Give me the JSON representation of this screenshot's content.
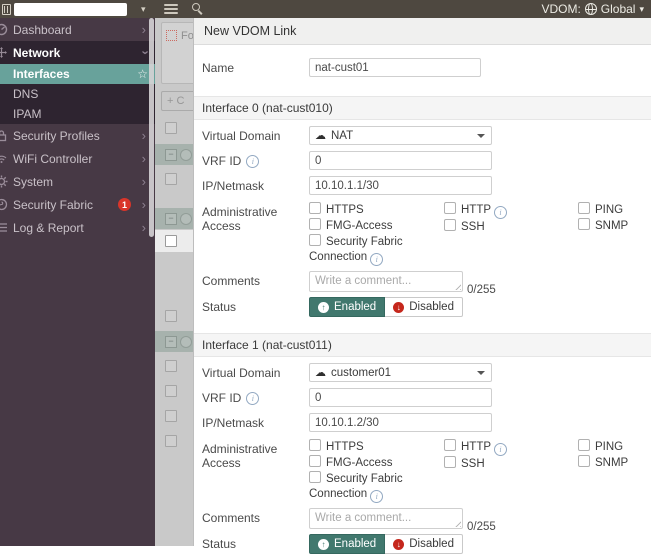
{
  "topbar": {
    "vdom_label": "VDOM:",
    "vdom_value": "Global"
  },
  "icons": {
    "chevron_right": "›",
    "star": "☆",
    "cloud": "☁",
    "info": "i",
    "up_arrow": "↑",
    "down_arrow": "↓",
    "minus": "−",
    "caret_down": "▾"
  },
  "sidebar": {
    "items": [
      {
        "label": "Dashboard",
        "icon": "gauge-icon"
      },
      {
        "label": "Network",
        "icon": "move-arrows-icon",
        "expanded": true,
        "children": [
          {
            "label": "Interfaces",
            "selected": true,
            "pinned": true
          },
          {
            "label": "DNS"
          },
          {
            "label": "IPAM"
          }
        ]
      },
      {
        "label": "Security Profiles",
        "icon": "lock-icon"
      },
      {
        "label": "WiFi Controller",
        "icon": "wifi-icon"
      },
      {
        "label": "System",
        "icon": "gear-icon"
      },
      {
        "label": "Security Fabric",
        "icon": "fabric-icon",
        "badge": "1"
      },
      {
        "label": "Log & Report",
        "icon": "report-icon"
      }
    ]
  },
  "background_page": {
    "widget_label": "Fo",
    "create_label": "+ C"
  },
  "panel": {
    "title": "New VDOM Link",
    "name": {
      "label": "Name",
      "value": "nat-cust01"
    },
    "labels": {
      "virtual_domain": "Virtual Domain",
      "vrf_id": "VRF ID",
      "ip_netmask": "IP/Netmask",
      "admin_access": "Administrative Access",
      "comments": "Comments",
      "comments_placeholder": "Write a comment...",
      "comments_counter": "0/255",
      "status": "Status",
      "enabled": "Enabled",
      "disabled": "Disabled"
    },
    "admin_access": {
      "col1": [
        "HTTPS",
        "FMG-Access",
        "Security Fabric Connection"
      ],
      "col2": [
        "HTTP",
        "SSH"
      ],
      "col3": [
        "PING",
        "SNMP"
      ]
    },
    "interfaces": [
      {
        "section_title": "Interface 0 (nat-cust010)",
        "virtual_domain": "NAT",
        "vrf_id": "0",
        "ip_netmask": "10.10.1.1/30",
        "status": "Enabled"
      },
      {
        "section_title": "Interface 1 (nat-cust011)",
        "virtual_domain": "customer01",
        "vrf_id": "0",
        "ip_netmask": "10.10.1.2/30",
        "status": "Enabled"
      }
    ]
  },
  "colors": {
    "topbar_bg": "#4e4840",
    "sidebar_bg": "#473945",
    "sidebar_expanded_bg": "#2e2430",
    "selected_teal": "#68a29b",
    "enabled_green": "#41786e",
    "disabled_red": "#c5271c",
    "badge_red": "#d9352a"
  }
}
